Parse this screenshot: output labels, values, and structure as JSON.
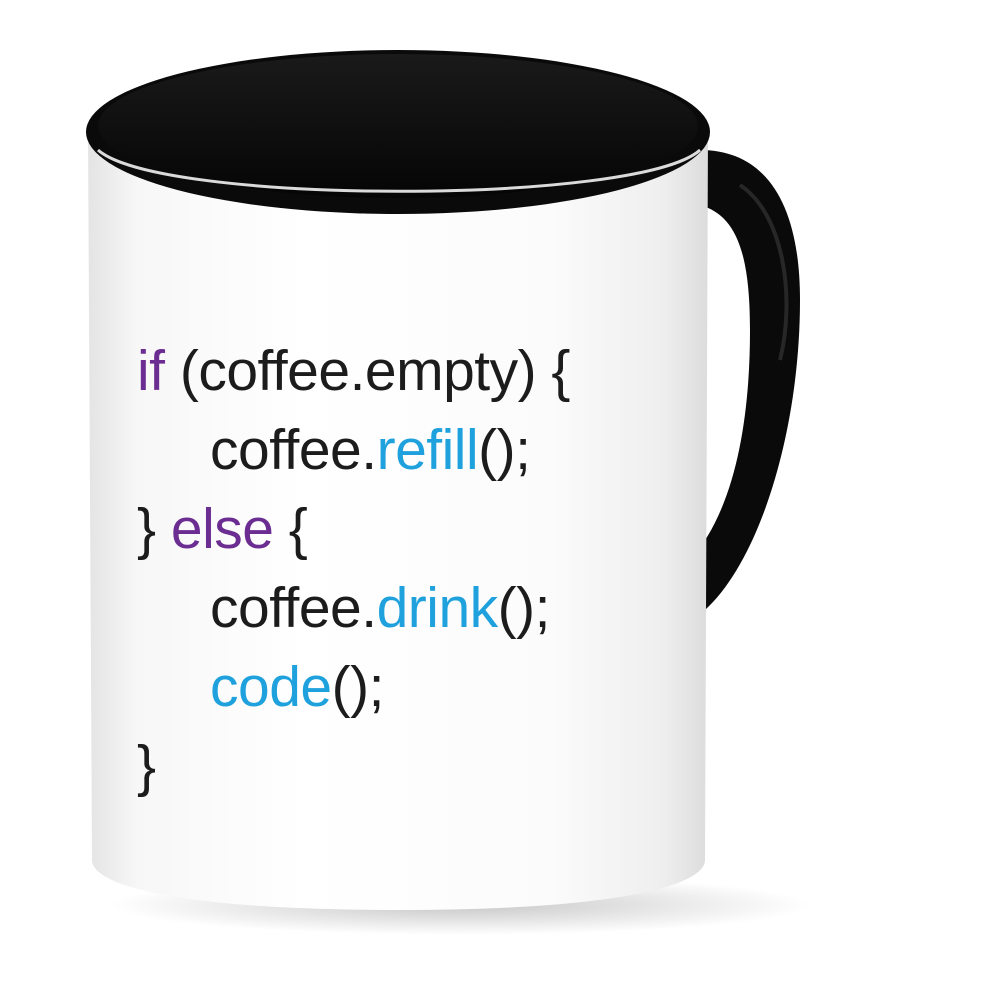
{
  "colors": {
    "keyword": "#6b2d91",
    "function": "#1ea1dc",
    "plain": "#1c1c1c",
    "mug_body": "#ffffff",
    "mug_rim": "#0a0a0a"
  },
  "code_lines": [
    [
      {
        "text": "if",
        "kind": "keyword"
      },
      {
        "text": " (coffee.empty) {",
        "kind": "plain"
      }
    ],
    [
      {
        "text": "coffee.",
        "kind": "plain"
      },
      {
        "text": "refill",
        "kind": "function"
      },
      {
        "text": "();",
        "kind": "plain"
      }
    ],
    [
      {
        "text": "} ",
        "kind": "plain"
      },
      {
        "text": "else",
        "kind": "keyword"
      },
      {
        "text": " {",
        "kind": "plain"
      }
    ],
    [
      {
        "text": "coffee.",
        "kind": "plain"
      },
      {
        "text": "drink",
        "kind": "function"
      },
      {
        "text": "();",
        "kind": "plain"
      }
    ],
    [
      {
        "text": "code",
        "kind": "function"
      },
      {
        "text": "();",
        "kind": "plain"
      }
    ],
    [
      {
        "text": "}",
        "kind": "plain"
      }
    ]
  ]
}
